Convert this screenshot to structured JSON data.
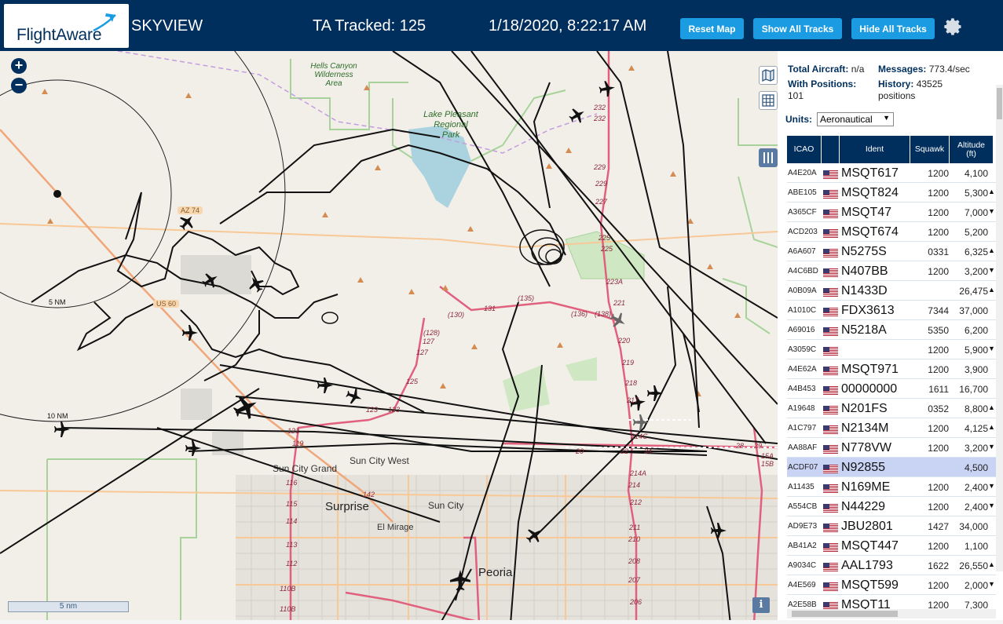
{
  "header": {
    "logo_text": "FlightAware",
    "app_title": "SKYVIEW",
    "tracked": "TA Tracked: 125",
    "datetime": "1/18/2020, 8:22:17 AM",
    "buttons": {
      "reset": "Reset Map",
      "show_all": "Show All Tracks",
      "hide_all": "Hide All Tracks"
    }
  },
  "map": {
    "zoom_in": "+",
    "zoom_out": "−",
    "scale_label": "5 nm",
    "info": "i",
    "labels": {
      "hells_canyon": [
        "Hells Canyon",
        "Wilderness",
        "Area"
      ],
      "lake_pleasant": [
        "Lake Pleasant",
        "Regional",
        "Park"
      ],
      "range_5nm": "5 NM",
      "range_10nm": "10 NM",
      "az74": "AZ 74",
      "us60": "US 60",
      "sun_city_west": "Sun City West",
      "sun_city_grand": "Sun City Grand",
      "surprise": "Surprise",
      "sun_city": "Sun City",
      "el_mirage": "El Mirage",
      "peoria": "Peoria"
    },
    "route_labels": [
      "232",
      "232",
      "229",
      "229",
      "227",
      "225",
      "225",
      "223A",
      "221",
      "220",
      "219",
      "218",
      "217",
      "214C",
      "214A",
      "214",
      "212",
      "211",
      "210",
      "208",
      "207",
      "206",
      "(135)",
      "(136)",
      "(138)",
      "(130)",
      "131",
      "(128)",
      "127",
      "127",
      "125",
      "123",
      "123",
      "121",
      "119",
      "116",
      "115",
      "114",
      "113",
      "112",
      "110B",
      "110B",
      "142",
      "28",
      "29",
      "15A",
      "15B",
      "20",
      "22",
      "24"
    ]
  },
  "sidebar": {
    "stats": {
      "total_aircraft_label": "Total Aircraft:",
      "total_aircraft_value": "n/a",
      "messages_label": "Messages:",
      "messages_value": "773.4/sec",
      "with_positions_label": "With Positions:",
      "with_positions_value": "101",
      "history_label": "History:",
      "history_value": "43525",
      "history_unit": "positions"
    },
    "units_label": "Units:",
    "units_value": "Aeronautical",
    "columns": {
      "icao": "ICAO",
      "ident": "Ident",
      "squawk": "Squawk",
      "altitude": "Altitude",
      "altitude_unit": "(ft)"
    },
    "rows": [
      {
        "icao": "A4E20A",
        "ident": "MSQT617",
        "squawk": "1200",
        "altitude": "4,100",
        "trend": ""
      },
      {
        "icao": "ABE105",
        "ident": "MSQT824",
        "squawk": "1200",
        "altitude": "5,300",
        "trend": "▲"
      },
      {
        "icao": "A365CF",
        "ident": "MSQT47",
        "squawk": "1200",
        "altitude": "7,000",
        "trend": "▼"
      },
      {
        "icao": "ACD203",
        "ident": "MSQT674",
        "squawk": "1200",
        "altitude": "5,200",
        "trend": ""
      },
      {
        "icao": "A6A607",
        "ident": "N5275S",
        "squawk": "0331",
        "altitude": "6,325",
        "trend": "▲"
      },
      {
        "icao": "A4C6BD",
        "ident": "N407BB",
        "squawk": "1200",
        "altitude": "3,200",
        "trend": "▼"
      },
      {
        "icao": "A0B09A",
        "ident": "N1433D",
        "squawk": "",
        "altitude": "26,475",
        "trend": "▲"
      },
      {
        "icao": "A1010C",
        "ident": "FDX3613",
        "squawk": "7344",
        "altitude": "37,000",
        "trend": ""
      },
      {
        "icao": "A69016",
        "ident": "N5218A",
        "squawk": "5350",
        "altitude": "6,200",
        "trend": ""
      },
      {
        "icao": "A3059C",
        "ident": "",
        "squawk": "1200",
        "altitude": "5,900",
        "trend": "▼"
      },
      {
        "icao": "A4E62A",
        "ident": "MSQT971",
        "squawk": "1200",
        "altitude": "3,900",
        "trend": ""
      },
      {
        "icao": "A4B453",
        "ident": "00000000",
        "squawk": "1611",
        "altitude": "16,700",
        "trend": ""
      },
      {
        "icao": "A19648",
        "ident": "N201FS",
        "squawk": "0352",
        "altitude": "8,800",
        "trend": "▲"
      },
      {
        "icao": "A1C797",
        "ident": "N2134M",
        "squawk": "1200",
        "altitude": "4,125",
        "trend": "▲"
      },
      {
        "icao": "AA88AF",
        "ident": "N778VW",
        "squawk": "1200",
        "altitude": "3,200",
        "trend": "▼"
      },
      {
        "icao": "ACDF07",
        "ident": "N92855",
        "squawk": "",
        "altitude": "4,500",
        "trend": "",
        "selected": true
      },
      {
        "icao": "A11435",
        "ident": "N169ME",
        "squawk": "1200",
        "altitude": "2,400",
        "trend": "▼"
      },
      {
        "icao": "A554CB",
        "ident": "N44229",
        "squawk": "1200",
        "altitude": "2,400",
        "trend": "▼"
      },
      {
        "icao": "AD9E73",
        "ident": "JBU2801",
        "squawk": "1427",
        "altitude": "34,000",
        "trend": ""
      },
      {
        "icao": "AB41A2",
        "ident": "MSQT447",
        "squawk": "1200",
        "altitude": "1,100",
        "trend": ""
      },
      {
        "icao": "A9034C",
        "ident": "AAL1793",
        "squawk": "1622",
        "altitude": "26,550",
        "trend": "▲"
      },
      {
        "icao": "A4E569",
        "ident": "MSQT599",
        "squawk": "1200",
        "altitude": "2,000",
        "trend": "▼"
      },
      {
        "icao": "A2E58B",
        "ident": "MSQT11",
        "squawk": "1200",
        "altitude": "7,300",
        "trend": ""
      }
    ]
  },
  "colors": {
    "header_bg": "#002f5d",
    "button_bg": "#1b9ce2",
    "selected_row": "#c9d3f3",
    "map_bg": "#f2efe9",
    "route_pink": "#e0607e"
  },
  "icons": [
    "plane-logo-icon",
    "gear-icon",
    "map-layers-icon",
    "grid-icon",
    "collapse-icon",
    "info-icon",
    "us-flag-icon",
    "aircraft-icon"
  ]
}
